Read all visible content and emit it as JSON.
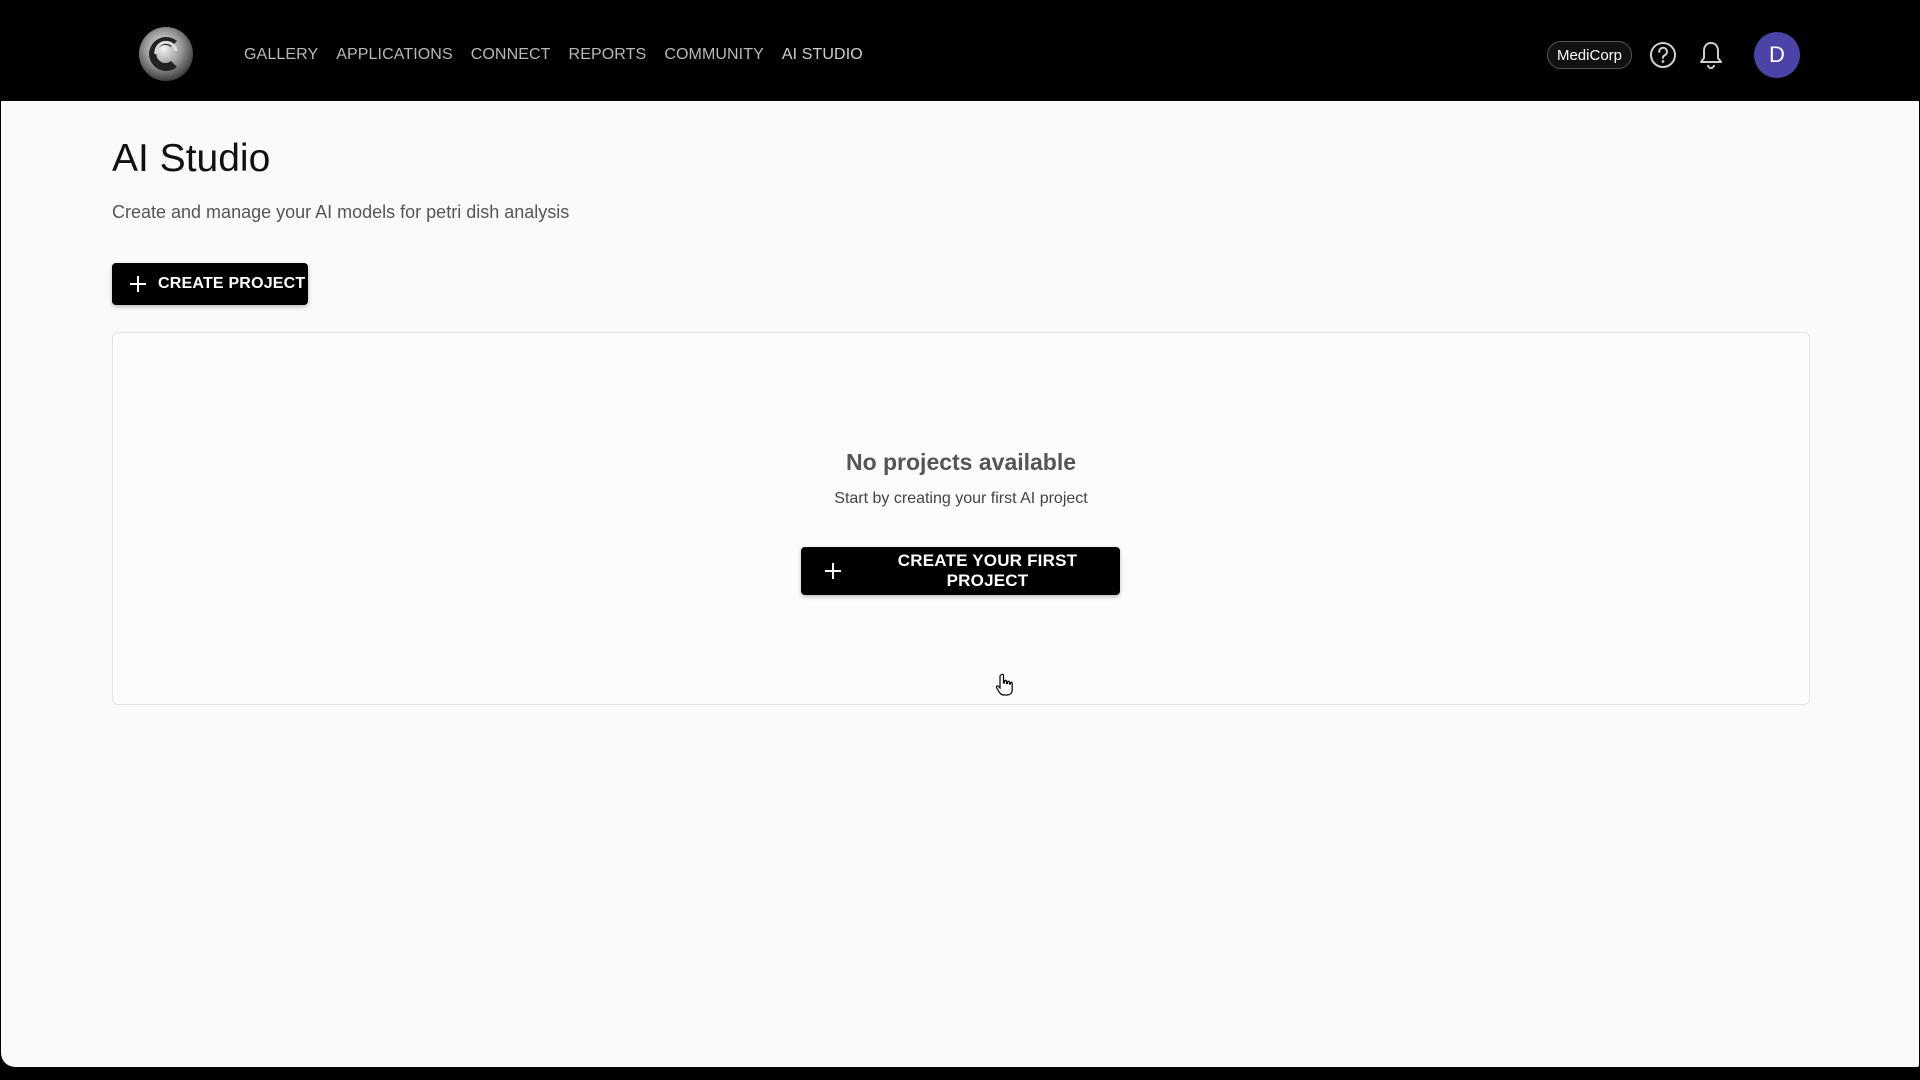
{
  "header": {
    "logo_icon": "circular-c-logo-icon",
    "nav": [
      {
        "label": "GALLERY"
      },
      {
        "label": "APPLICATIONS"
      },
      {
        "label": "CONNECT"
      },
      {
        "label": "REPORTS"
      },
      {
        "label": "COMMUNITY"
      },
      {
        "label": "AI STUDIO"
      }
    ],
    "organization": "MediCorp",
    "help_icon": "help-circle-icon",
    "notification_icon": "bell-icon",
    "avatar_initial": "D",
    "avatar_color": "#4b43a6"
  },
  "page": {
    "title": "AI Studio",
    "subtitle": "Create and manage your AI models for petri dish analysis",
    "create_button": "CREATE PROJECT"
  },
  "empty_state": {
    "title": "No projects available",
    "description": "Start by creating your first AI project",
    "button": "CREATE YOUR FIRST PROJECT"
  },
  "colors": {
    "header_bg": "#000000",
    "page_bg": "#fafafa",
    "button_bg": "#000000",
    "button_text": "#ffffff"
  }
}
